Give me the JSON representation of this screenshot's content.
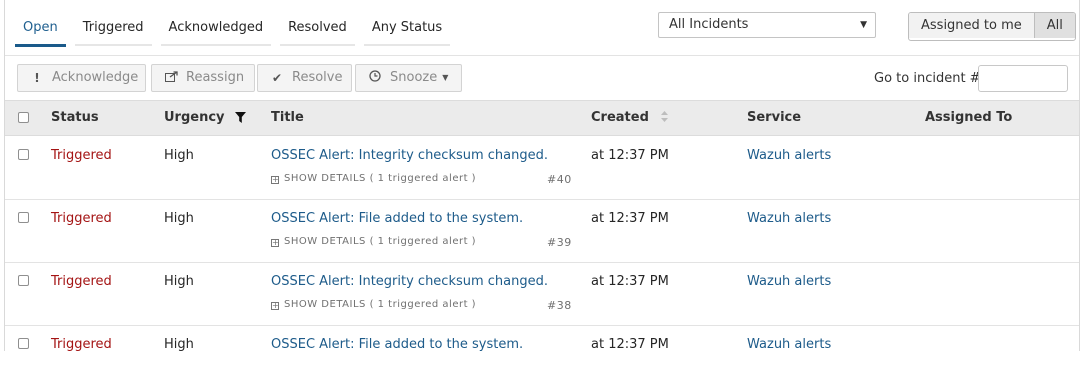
{
  "tabs": [
    {
      "label": "Open"
    },
    {
      "label": "Triggered"
    },
    {
      "label": "Acknowledged"
    },
    {
      "label": "Resolved"
    },
    {
      "label": "Any Status"
    }
  ],
  "filter": {
    "selected": "All Incidents"
  },
  "assign_toggle": {
    "me": "Assigned to me",
    "all": "All"
  },
  "toolbar": {
    "acknowledge": "Acknowledge",
    "reassign": "Reassign",
    "resolve": "Resolve",
    "snooze": "Snooze",
    "goto_label": "Go to incident # :"
  },
  "table": {
    "headers": {
      "status": "Status",
      "urgency": "Urgency",
      "title": "Title",
      "created": "Created",
      "service": "Service",
      "assigned": "Assigned To"
    },
    "rows": [
      {
        "status": "Triggered",
        "urgency": "High",
        "title": "OSSEC Alert: Integrity checksum changed.",
        "details": "SHOW DETAILS",
        "alerts": "( 1 triggered alert )",
        "number": "#40",
        "created": "at 12:37 PM",
        "service": "Wazuh alerts"
      },
      {
        "status": "Triggered",
        "urgency": "High",
        "title": "OSSEC Alert: File added to the system.",
        "details": "SHOW DETAILS",
        "alerts": "( 1 triggered alert )",
        "number": "#39",
        "created": "at 12:37 PM",
        "service": "Wazuh alerts"
      },
      {
        "status": "Triggered",
        "urgency": "High",
        "title": "OSSEC Alert: Integrity checksum changed.",
        "details": "SHOW DETAILS",
        "alerts": "( 1 triggered alert )",
        "number": "#38",
        "created": "at 12:37 PM",
        "service": "Wazuh alerts"
      },
      {
        "status": "Triggered",
        "urgency": "High",
        "title": "OSSEC Alert: File added to the system.",
        "details": "",
        "alerts": "",
        "number": "",
        "created": "at 12:37 PM",
        "service": "Wazuh alerts"
      }
    ]
  },
  "colors": {
    "accent": "#1a5a8a",
    "triggered": "#a41414",
    "link": "#1d5b8a"
  }
}
